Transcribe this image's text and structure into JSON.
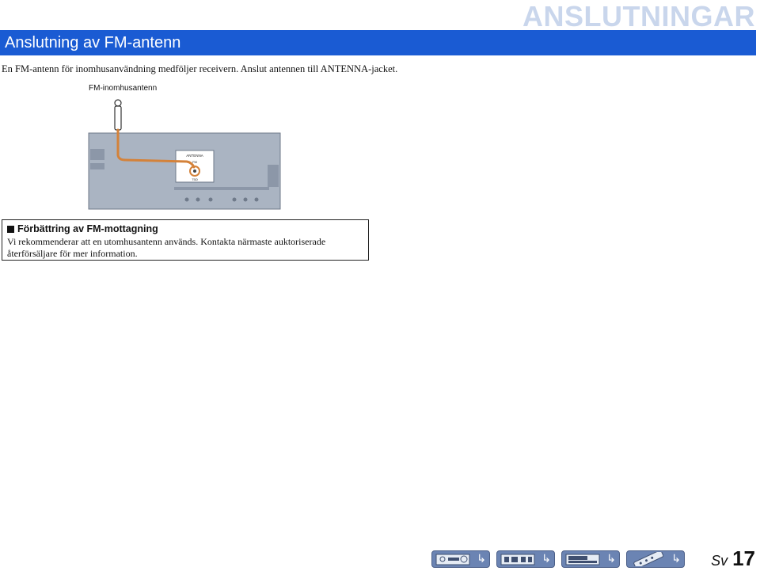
{
  "header": {
    "chapter": "ANSLUTNINGAR"
  },
  "section": {
    "title": "Anslutning av FM-antenn"
  },
  "intro": "En FM-antenn för inomhusanvändning medföljer receivern. Anslut antennen till ANTENNA-jacket.",
  "diagram": {
    "antenna_label": "FM-inomhusantenn",
    "panel_label": "ANTENNA",
    "fm_label": "FM",
    "ohm_label": "75Ω"
  },
  "tip": {
    "heading": "Förbättring av FM-mottagning",
    "body": "Vi rekommenderar att en utomhusantenn används. Kontakta närmaste auktoriserade återförsäljare för mer information."
  },
  "footer": {
    "lang": "Sv",
    "page": "17",
    "nav_icons": [
      "front-panel-icon",
      "rear-panel-icon",
      "display-icon",
      "remote-icon"
    ],
    "arrow": "↳"
  },
  "colors": {
    "accent": "#1a5bd3",
    "chapter": "#c9d6ec",
    "cable": "#d4823a",
    "panel": "#9aa5b5"
  }
}
